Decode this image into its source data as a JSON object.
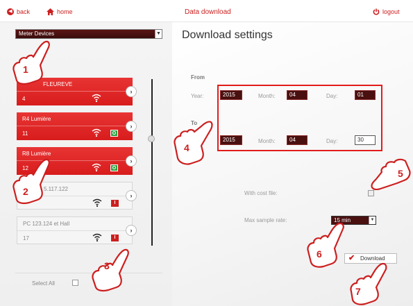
{
  "header": {
    "back_label": "back",
    "home_label": "home",
    "title": "Data download",
    "logout_label": "logout"
  },
  "sidebar": {
    "device_select": "Meter Devices",
    "devices": [
      {
        "name": "FLEUREVE",
        "count": "4",
        "color": "red",
        "status": ""
      },
      {
        "name": "R4 Lumière",
        "count": "11",
        "color": "red",
        "status": "O"
      },
      {
        "name": "R8 Lumière",
        "count": "12",
        "color": "red",
        "status": "O"
      },
      {
        "name": "5.117.122",
        "count": "",
        "color": "grey",
        "status": "I"
      },
      {
        "name": "PC 123.124 et Hall",
        "count": "17",
        "color": "grey",
        "status": "I"
      }
    ],
    "select_all_label": "Select All"
  },
  "main": {
    "title": "Download settings",
    "from_label": "From",
    "to_label": "To",
    "year_label": "Year:",
    "month_label": "Month:",
    "day_label": "Day:",
    "from": {
      "year": "2015",
      "month": "04",
      "day": "01"
    },
    "to": {
      "year": "2015",
      "month": "04",
      "day": "30"
    },
    "cost_file_label": "With cost file:",
    "sample_rate_label": "Max sample rate:",
    "sample_rate_value": "15 min",
    "download_label": "Download"
  },
  "annotations": [
    "1",
    "2",
    "3",
    "4",
    "5",
    "6",
    "7"
  ],
  "colors": {
    "accent": "#cc1f1f",
    "field_bg": "#4a1010",
    "status_green": "#2ea043"
  }
}
